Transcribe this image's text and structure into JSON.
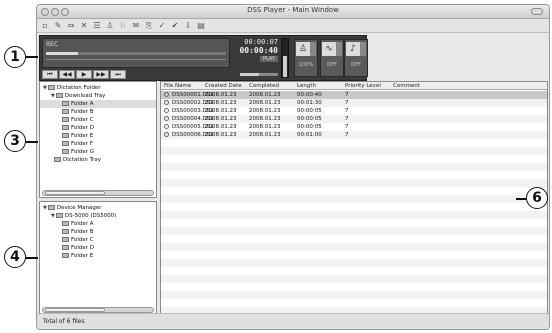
{
  "window": {
    "title": "DSS Player - Main Window"
  },
  "callouts": [
    "1",
    "3",
    "4",
    "6"
  ],
  "toolbar": {
    "icons": [
      "new-icon",
      "pen-icon",
      "move-icon",
      "delete-icon",
      "list-icon",
      "play-icon",
      "rec-icon",
      "mail-icon",
      "export-icon",
      "check-icon",
      "check2-icon",
      "download-icon",
      "info-icon"
    ]
  },
  "transport": {
    "rec_label": "REC",
    "progress": 0.18,
    "time_elapsed": "00:00:07",
    "time_total": "00:00:40",
    "mode_label": "PLAY",
    "meter_level": 0.55,
    "volume": 0.5,
    "knobs": [
      {
        "name": "speed",
        "symbol": "♙",
        "value": "100%"
      },
      {
        "name": "noise-cancel",
        "symbol": "∿",
        "value": "OFF"
      },
      {
        "name": "voice-filter",
        "symbol": "♪",
        "value": "OFF"
      }
    ],
    "controls": [
      "⏮",
      "◀◀",
      "▶",
      "▶▶",
      "⏭"
    ]
  },
  "dictation_tree": {
    "root": "Dictation Folder",
    "download_tray": "Download Tray",
    "folders": [
      "Folder A",
      "Folder B",
      "Folder C",
      "Folder D",
      "Folder E",
      "Folder F",
      "Folder G"
    ],
    "tray": "Dictation Tray"
  },
  "device_tree": {
    "root": "Device Manager",
    "device": "DS-5000 (DS5000)",
    "folders": [
      "Folder A",
      "Folder B",
      "Folder C",
      "Folder D",
      "Folder E"
    ]
  },
  "file_list": {
    "columns": [
      "File Name",
      "Created Date",
      "Completed",
      "Length",
      "Priority Level",
      "Comment"
    ],
    "rows": [
      {
        "name": "DSS00001.DS2",
        "created": "2008.01.23",
        "completed": "2008.01.23",
        "length": "00:00:40",
        "priority": "7",
        "comment": ""
      },
      {
        "name": "DSS00002.DS2",
        "created": "2008.01.23",
        "completed": "2008.01.23",
        "length": "00:01:30",
        "priority": "7",
        "comment": ""
      },
      {
        "name": "DSS00003.DS2",
        "created": "2008.01.23",
        "completed": "2008.01.23",
        "length": "00:00:05",
        "priority": "7",
        "comment": ""
      },
      {
        "name": "DSS00004.DS2",
        "created": "2008.01.23",
        "completed": "2008.01.23",
        "length": "00:00:05",
        "priority": "7",
        "comment": ""
      },
      {
        "name": "DSS00005.DS2",
        "created": "2008.01.23",
        "completed": "2008.01.23",
        "length": "00:00:05",
        "priority": "7",
        "comment": ""
      },
      {
        "name": "DSS00006.DS2",
        "created": "2008.01.23",
        "completed": "2008.01.23",
        "length": "00:01:00",
        "priority": "7",
        "comment": ""
      }
    ]
  },
  "status": {
    "text": "Total of 6 files"
  }
}
